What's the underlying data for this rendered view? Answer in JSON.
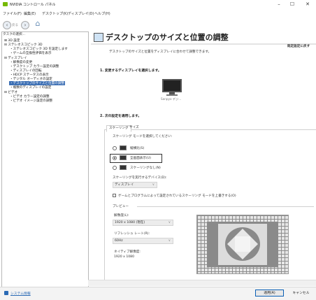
{
  "window": {
    "title": "NVIDIA コントロール パネル",
    "minimize_glyph": "–",
    "maximize_glyph": "☐",
    "close_glyph": "✕"
  },
  "menu": [
    "ファイル(F)",
    "編集(E)",
    "デスクトップ(K)",
    "ディスプレイ(D)",
    "ヘルプ(H)"
  ],
  "toolbar": {
    "back_label": "戻る",
    "back_glyph": "‹",
    "forward_glyph": "›",
    "home_glyph": "⌂"
  },
  "tree": {
    "header": "タスクの選択...",
    "items": [
      "⊞ 3D 設定",
      "⊟ ステレオスコピック 3D",
      "・ステレオスコピック 3D を設定します",
      "・ゲームの互換性評価を表示",
      "⊟ ディスプレイ",
      "・解像度の変更",
      "・デスクトップ カラー設定の調整",
      "・ディスプレイの回転",
      "・HDCP ステータスの表示",
      "・デジタル オーディオの設定",
      "・デスクトップのサイズと位置の調整",
      "・複数のディスプレイの設定",
      "⊟ ビデオ",
      "・ビデオ カラー設定の調整",
      "・ビデオ イメージ設定の調整"
    ]
  },
  "header": {
    "title": "デスクトップのサイズと位置の調整",
    "restore": "既定設定に戻す",
    "description": "デスクトップのサイズと位置をディスプレイに合わせて調整できます。"
  },
  "step1": {
    "title": "1. 変更するディスプレイを選択します。",
    "monitor_label": "Sanpyo デジ..."
  },
  "step2": {
    "title": "2. 次の設定を適用します。",
    "tabs": [
      "スケーリング",
      "サイズ"
    ],
    "scaling_mode_label": "スケーリング モードを選択してください:",
    "options": [
      "縦横比(S)",
      "全画面表示(U)",
      "スケーリングなし(N)"
    ],
    "perform_on_label": "スケーリングを実行するデバイス(D):",
    "perform_on_value": "ディスプレイ",
    "override_label": "ゲームとプログラムによって設定されているスケーリング モードを上書きする(O)",
    "preview_label": "プレビュー",
    "resolution_label": "解像度(L):",
    "resolution_value": "1920 x 1080 (現在)",
    "refresh_label": "リフレッシュ レート(R):",
    "refresh_value": "60Hz",
    "native_label": "ネイティブ解像度:",
    "native_value": "1920 x 1080",
    "combo_arrow": "∨"
  },
  "footer": {
    "sysinfo": "システム情報",
    "apply": "適用(A)",
    "cancel": "キャンセル"
  }
}
